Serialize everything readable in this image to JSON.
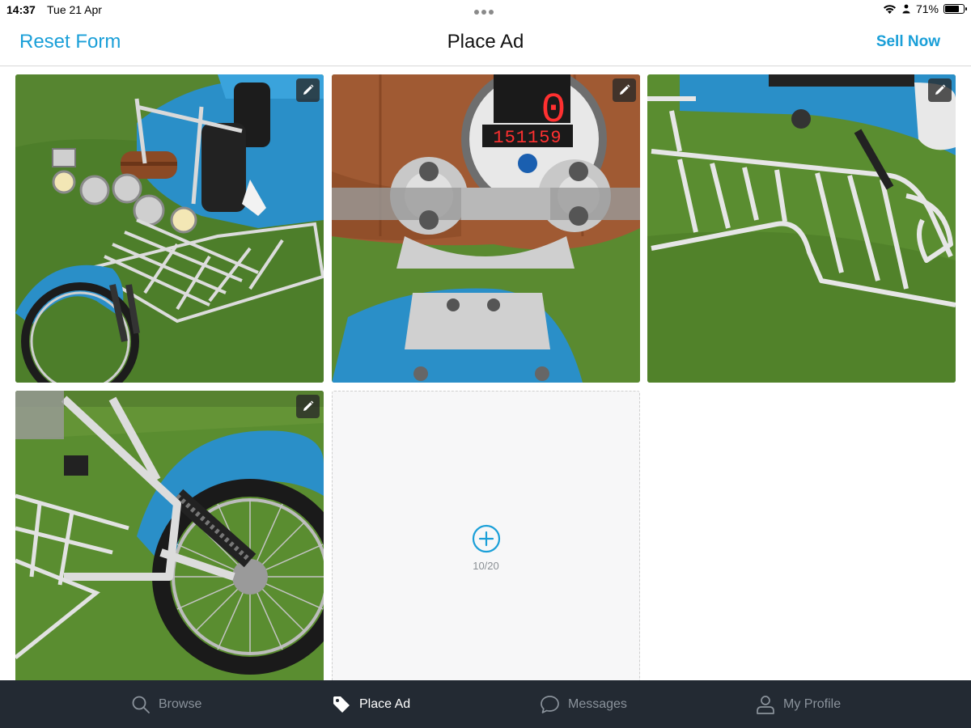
{
  "status_bar": {
    "time": "14:37",
    "date": "Tue 21 Apr",
    "battery_percent": "71%",
    "battery_level": 0.71,
    "icons": [
      "wifi-icon",
      "location-icon",
      "battery-icon"
    ]
  },
  "nav": {
    "left_action": "Reset Form",
    "title": "Place Ad",
    "right_action": "Sell Now"
  },
  "photos": [
    {
      "subject": "blue trike front view with chrome rack",
      "edit_icon": "pencil-icon"
    },
    {
      "subject": "speedometer and handlebar clamp",
      "edit_icon": "pencil-icon",
      "speedo_reading": "0",
      "odometer_reading": "151159"
    },
    {
      "subject": "chrome luggage rack close-up",
      "edit_icon": "pencil-icon"
    },
    {
      "subject": "rear wheel and blue mudguard",
      "edit_icon": "pencil-icon"
    }
  ],
  "add_photo": {
    "icon": "plus-circle-icon",
    "count": "10/20"
  },
  "tabs": [
    {
      "label": "Browse",
      "icon": "search-icon",
      "active": false
    },
    {
      "label": "Place Ad",
      "icon": "tag-icon",
      "active": true
    },
    {
      "label": "Messages",
      "icon": "chat-bubble-icon",
      "active": false
    },
    {
      "label": "My Profile",
      "icon": "person-icon",
      "active": false
    }
  ],
  "colors": {
    "accent": "#1a9fd8",
    "tab_bar_bg": "#232a33",
    "tab_inactive": "#8b939c",
    "tab_active": "#ffffff"
  }
}
